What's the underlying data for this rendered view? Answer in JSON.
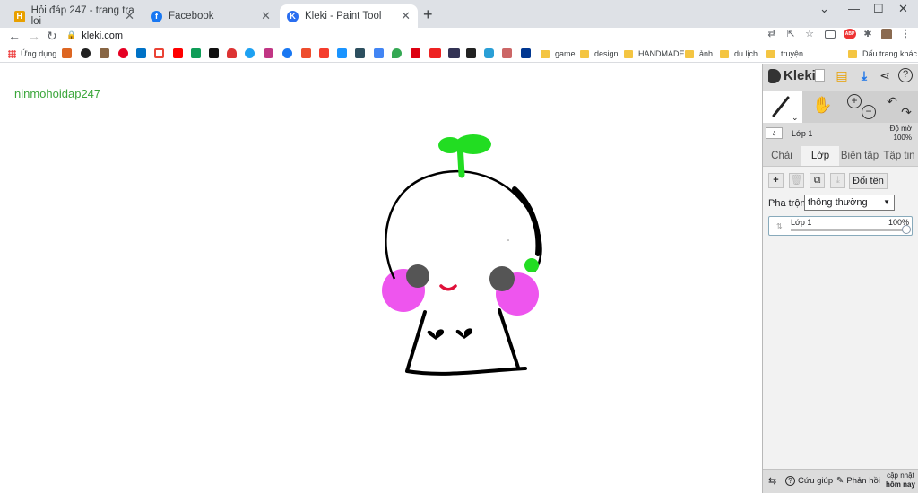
{
  "browser": {
    "tabs": [
      {
        "title": "Hỏi đáp 247 - trang tra loi",
        "favicon": "H"
      },
      {
        "title": "Facebook",
        "favicon": "f"
      },
      {
        "title": "Kleki - Paint Tool",
        "favicon": "K"
      }
    ],
    "url": "kleki.com",
    "bookmarks": {
      "apps": "Ứng dụng",
      "folders": [
        "game",
        "design",
        "HANDMADE",
        "ảnh",
        "du lịch",
        "truyện"
      ],
      "other": "Dấu trang khác"
    },
    "ext_badge": "ABP"
  },
  "canvas": {
    "watermark": "ninmohoidap247",
    "colors": {
      "sprout": "#22dd22",
      "cheek": "#ee55ee",
      "eye": "#555555",
      "mouth": "#e0103a"
    }
  },
  "panel": {
    "logo": "Kleki",
    "layer_name": "Lớp 1",
    "opacity_label": "Độ mờ",
    "opacity_value": "100%",
    "tabs": [
      "Chải",
      "Lớp",
      "Biên tập",
      "Tập tin"
    ],
    "active_tab": "Lớp",
    "rename_button": "Đổi tên",
    "blend_label": "Pha trộn",
    "blend_value": "thông thường",
    "layer_card": {
      "name": "Lớp 1",
      "opacity": "100%"
    },
    "bottom": {
      "help": "Cứu giúp",
      "feedback": "Phản hồi",
      "update_line1": "cập nhật",
      "update_line2": "hôm nay"
    }
  }
}
